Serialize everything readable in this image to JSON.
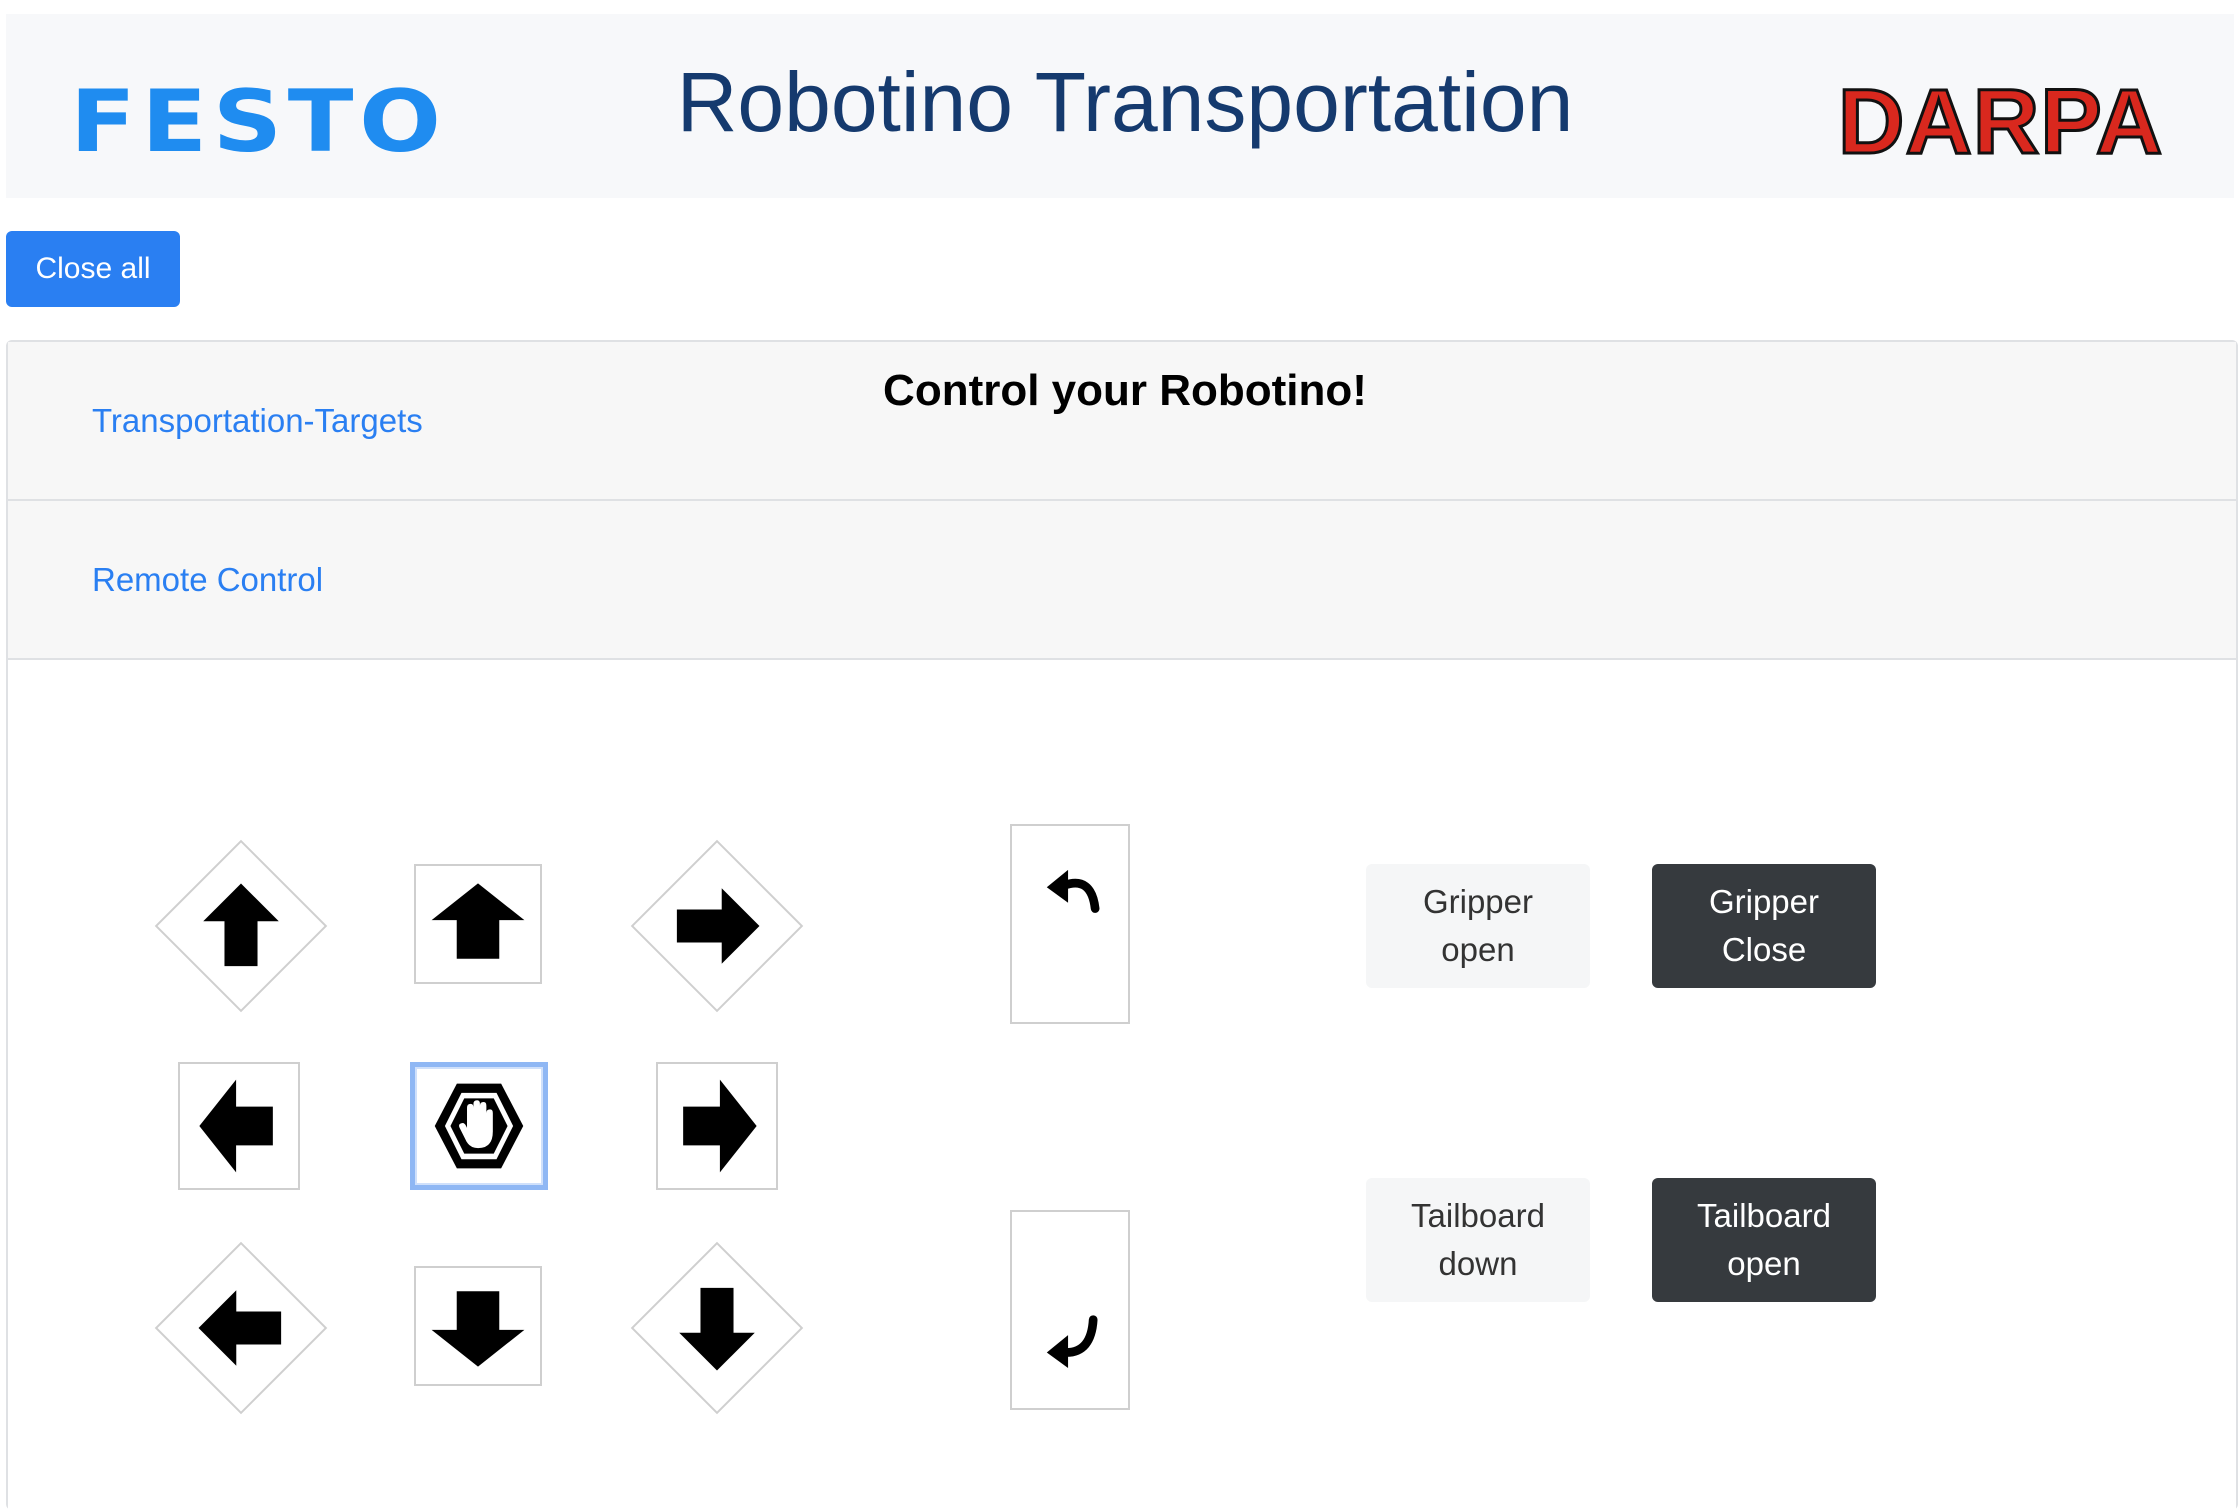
{
  "header": {
    "title": "Robotino Transportation",
    "logo_left": "FESTO",
    "logo_right": "DARPA"
  },
  "toolbar": {
    "close_all_label": "Close all"
  },
  "accordion": {
    "sections": [
      {
        "label": "Transportation-Targets"
      },
      {
        "label": "Remote Control"
      }
    ]
  },
  "remote": {
    "title": "Control your Robotino!",
    "move_icons": [
      "arrow-up-left-icon",
      "arrow-up-icon",
      "arrow-up-right-icon",
      "arrow-left-icon",
      "stop-hand-icon",
      "arrow-right-icon",
      "arrow-down-left-icon",
      "arrow-down-icon",
      "arrow-down-right-icon"
    ],
    "rotate_icons": [
      "rotate-left-icon",
      "rotate-right-icon"
    ],
    "gripper_open": {
      "line1": "Gripper",
      "line2": "open"
    },
    "gripper_close": {
      "line1": "Gripper",
      "line2": "Close"
    },
    "tailboard_down": {
      "line1": "Tailboard",
      "line2": "down"
    },
    "tailboard_open": {
      "line1": "Tailboard",
      "line2": "open"
    }
  },
  "colors": {
    "brand_blue": "#1f8cf0",
    "title_navy": "#153a6e",
    "darpa_red": "#d9281e",
    "primary_button": "#2a7ff2",
    "dark_button": "#363a3e"
  }
}
